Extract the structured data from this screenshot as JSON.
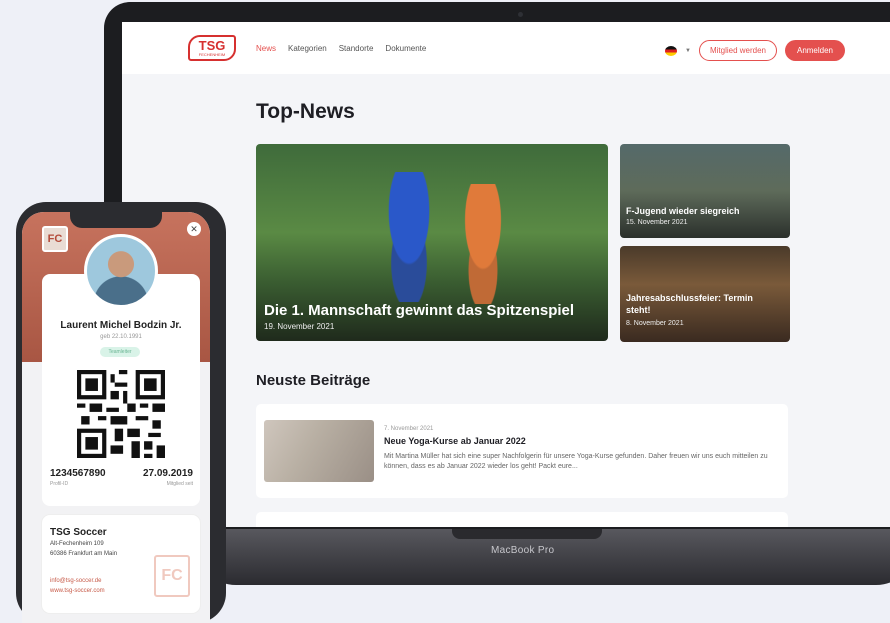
{
  "site": {
    "logo_main": "TSG",
    "logo_sub": "FECHENHEIM",
    "nav": [
      {
        "label": "News",
        "active": true
      },
      {
        "label": "Kategorien",
        "active": false
      },
      {
        "label": "Standorte",
        "active": false
      },
      {
        "label": "Dokumente",
        "active": false
      }
    ],
    "join_label": "Mitglied werden",
    "login_label": "Anmelden",
    "accent": "#e4504e"
  },
  "top_news": {
    "heading": "Top-News",
    "items": [
      {
        "title": "Die 1. Mannschaft gewinnt das Spitzenspiel",
        "date": "19. November 2021"
      },
      {
        "title": "F-Jugend wieder siegreich",
        "date": "15. November 2021"
      },
      {
        "title": "Jahresabschlussfeier: Termin steht!",
        "date": "8. November 2021"
      }
    ]
  },
  "latest": {
    "heading": "Neuste Beiträge",
    "post": {
      "date": "7. November 2021",
      "title": "Neue Yoga-Kurse ab Januar 2022",
      "text": "Mit Martina Müller hat sich eine super Nachfolgerin für unsere Yoga-Kurse gefunden. Daher freuen wir uns euch mitteilen zu können, dass es ab Januar 2022 wieder los geht! Packt eure..."
    }
  },
  "laptop": {
    "brand": "MacBook Pro"
  },
  "member": {
    "name": "Laurent Michel Bodzin Jr.",
    "dob": "geb 22.10.1991",
    "badge": "Teamleiter",
    "profile_id": "1234567890",
    "profile_id_label": "Profil-ID",
    "since": "27.09.2019",
    "since_label": "Mitglied seit",
    "fc_label": "FC"
  },
  "club": {
    "name": "TSG Soccer",
    "street": "Alt-Fechenheim 109",
    "city": "60386 Frankfurt am Main",
    "email": "info@tsg-soccer.de",
    "web": "www.tsg-soccer.com"
  }
}
